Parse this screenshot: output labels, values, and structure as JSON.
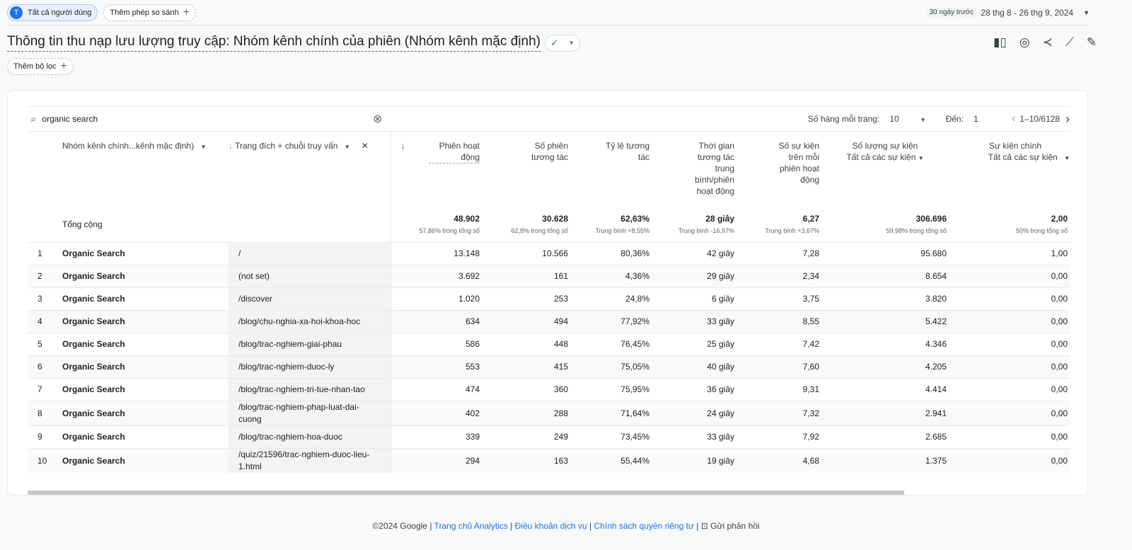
{
  "segment": {
    "initial": "T",
    "label": "Tất cả người dùng"
  },
  "compare_label": "Thêm phép so sánh",
  "date": {
    "preset": "30 ngày trước",
    "range": "28 thg 8 - 26 thg 9, 2024"
  },
  "title": "Thông tin thu nạp lưu lượng truy cập: Nhóm kênh chính của phiên (Nhóm kênh mặc định)",
  "filter_label": "Thêm bộ lọc",
  "search": {
    "value": "organic search"
  },
  "pager": {
    "rows_label": "Số hàng mỗi trang:",
    "rows": "10",
    "goto_label": "Đến:",
    "goto": "1",
    "range": "1–10/6128"
  },
  "columns": {
    "dim1": "Nhóm kênh chính...kênh mặc định)",
    "dim2": "Trang đích + chuỗi truy vấn",
    "metrics": [
      "Phiên hoạt động",
      "Số phiên tương tác",
      "Tỷ lệ tương tác",
      "Thời gian tương tác trung bình/phiên hoạt động",
      "Số sự kiện trên mỗi phiên hoạt động",
      "Số lượng sự kiện",
      "Sự kiện chính"
    ],
    "event_filter": "Tất cả các sự kiện"
  },
  "totals": {
    "label": "Tổng cộng",
    "values": [
      "48.902",
      "30.628",
      "62,63%",
      "28 giây",
      "6,27",
      "306.696",
      "2,00"
    ],
    "subs": [
      "57,86% trong tổng số",
      "62,8% trong tổng số",
      "Trung bình +8,55%",
      "Trung bình -16,97%",
      "Trung bình +3,67%",
      "59,98% trong tổng số",
      "50% trong tổng số"
    ]
  },
  "rows": [
    {
      "i": "1",
      "ch": "Organic Search",
      "lp": "/",
      "v": [
        "13.148",
        "10.566",
        "80,36%",
        "42 giây",
        "7,28",
        "95.680",
        "1,00"
      ]
    },
    {
      "i": "2",
      "ch": "Organic Search",
      "lp": "(not set)",
      "v": [
        "3.692",
        "161",
        "4,36%",
        "29 giây",
        "2,34",
        "8.654",
        "0,00"
      ]
    },
    {
      "i": "3",
      "ch": "Organic Search",
      "lp": "/discover",
      "v": [
        "1.020",
        "253",
        "24,8%",
        "6 giây",
        "3,75",
        "3.820",
        "0,00"
      ]
    },
    {
      "i": "4",
      "ch": "Organic Search",
      "lp": "/blog/chu-nghia-xa-hoi-khoa-hoc",
      "v": [
        "634",
        "494",
        "77,92%",
        "33 giây",
        "8,55",
        "5.422",
        "0,00"
      ]
    },
    {
      "i": "5",
      "ch": "Organic Search",
      "lp": "/blog/trac-nghiem-giai-phau",
      "v": [
        "586",
        "448",
        "76,45%",
        "25 giây",
        "7,42",
        "4.346",
        "0,00"
      ]
    },
    {
      "i": "6",
      "ch": "Organic Search",
      "lp": "/blog/trac-nghiem-duoc-ly",
      "v": [
        "553",
        "415",
        "75,05%",
        "40 giây",
        "7,60",
        "4.205",
        "0,00"
      ]
    },
    {
      "i": "7",
      "ch": "Organic Search",
      "lp": "/blog/trac-nghiem-tri-tue-nhan-tao",
      "v": [
        "474",
        "360",
        "75,95%",
        "36 giây",
        "9,31",
        "4.414",
        "0,00"
      ]
    },
    {
      "i": "8",
      "ch": "Organic Search",
      "lp": "/blog/trac-nghiem-phap-luat-dai-cuong",
      "v": [
        "402",
        "288",
        "71,64%",
        "24 giây",
        "7,32",
        "2.941",
        "0,00"
      ]
    },
    {
      "i": "9",
      "ch": "Organic Search",
      "lp": "/blog/trac-nghiem-hoa-duoc",
      "v": [
        "339",
        "249",
        "73,45%",
        "33 giây",
        "7,92",
        "2.685",
        "0,00"
      ]
    },
    {
      "i": "10",
      "ch": "Organic Search",
      "lp": "/quiz/21596/trac-nghiem-duoc-lieu-1.html",
      "v": [
        "294",
        "163",
        "55,44%",
        "19 giây",
        "4,68",
        "1.375",
        "0,00"
      ]
    }
  ],
  "footer": {
    "copyright": "©2024 Google",
    "links": [
      "Trang chủ Analytics",
      "Điều khoản dịch vụ",
      "Chính sách quyền riêng tư"
    ],
    "feedback": "Gửi phản hồi"
  },
  "colors": {
    "accent": "#1a73e8",
    "check": "#188038"
  }
}
